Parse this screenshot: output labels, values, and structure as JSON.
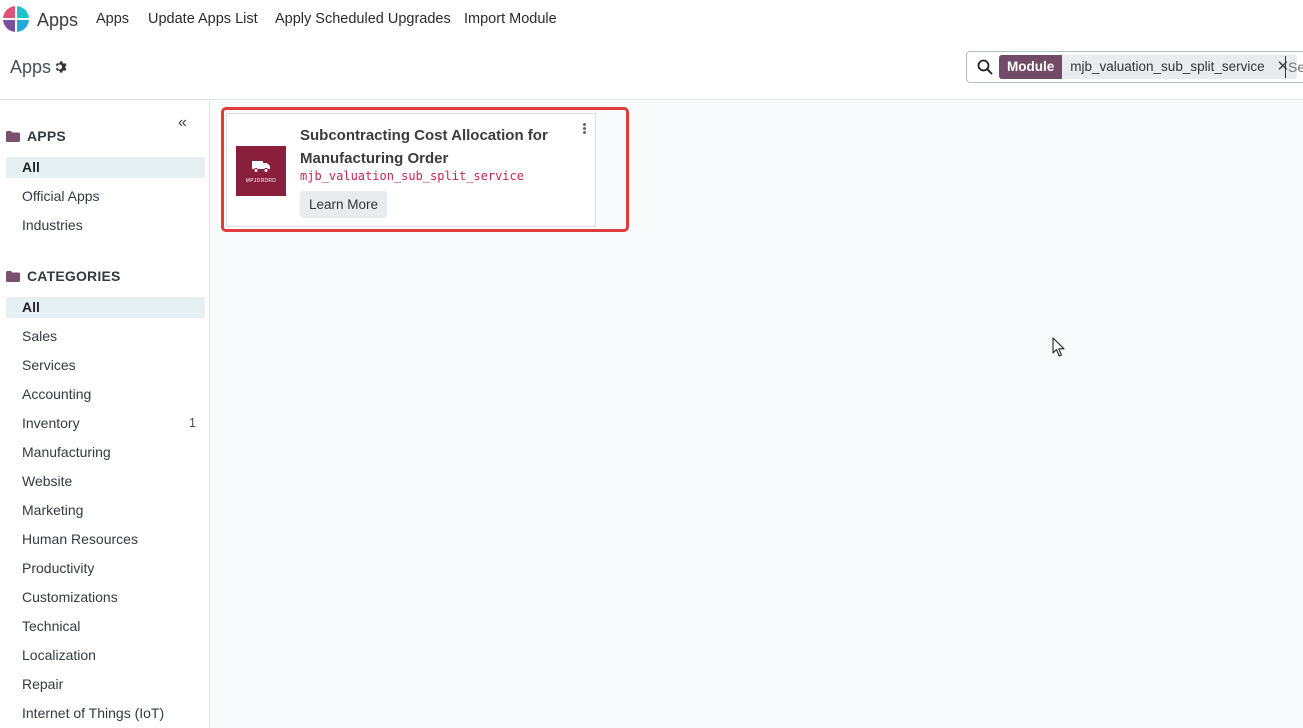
{
  "navbar": {
    "brand": "Apps",
    "menu": [
      "Apps",
      "Update Apps List",
      "Apply Scheduled Upgrades",
      "Import Module"
    ]
  },
  "control_panel": {
    "breadcrumb": "Apps",
    "search": {
      "facet_label": "Module",
      "facet_value": "mjb_valuation_sub_split_service",
      "placeholder": "Search..."
    }
  },
  "sidebar": {
    "apps_header": "APPS",
    "apps_items": [
      {
        "label": "All",
        "active": true
      },
      {
        "label": "Official Apps"
      },
      {
        "label": "Industries"
      }
    ],
    "categories_header": "CATEGORIES",
    "categories_items": [
      {
        "label": "All",
        "active": true
      },
      {
        "label": "Sales"
      },
      {
        "label": "Services"
      },
      {
        "label": "Accounting"
      },
      {
        "label": "Inventory",
        "count": "1"
      },
      {
        "label": "Manufacturing"
      },
      {
        "label": "Website"
      },
      {
        "label": "Marketing"
      },
      {
        "label": "Human Resources"
      },
      {
        "label": "Productivity"
      },
      {
        "label": "Customizations"
      },
      {
        "label": "Technical"
      },
      {
        "label": "Localization"
      },
      {
        "label": "Repair"
      },
      {
        "label": "Internet of Things (IoT)"
      }
    ]
  },
  "app_card": {
    "title": "Subcontracting Cost Allocation for Manufacturing Order",
    "technical_name": "mjb_valuation_sub_split_service",
    "button": "Learn More",
    "icon_text": "MPJDRDRD",
    "icon_color": "#8a1f3c"
  },
  "colors": {
    "accent": "#714b67",
    "highlight_border": "#e03c3c",
    "active_bg": "#e6f0f3"
  }
}
